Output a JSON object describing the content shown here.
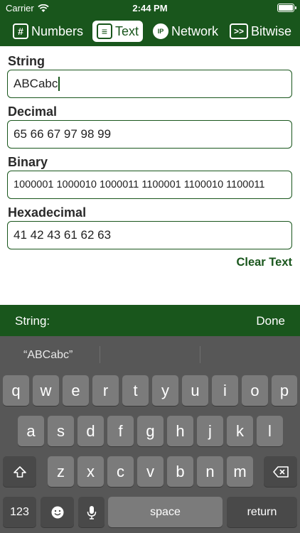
{
  "status": {
    "carrier": "Carrier",
    "time": "2:44 PM"
  },
  "tabs": [
    {
      "label": "Numbers",
      "icon": "#"
    },
    {
      "label": "Text",
      "icon": "≡"
    },
    {
      "label": "Network",
      "icon": "IP"
    },
    {
      "label": "Bitwise",
      "icon": ">>"
    }
  ],
  "fields": {
    "string": {
      "label": "String",
      "value": "ABCabc"
    },
    "decimal": {
      "label": "Decimal",
      "value": "65 66 67 97 98 99"
    },
    "binary": {
      "label": "Binary",
      "value": "1000001 1000010 1000011 1100001 1100010 1100011"
    },
    "hexadecimal": {
      "label": "Hexadecimal",
      "value": "41 42 43 61 62 63"
    }
  },
  "clear_label": "Clear Text",
  "accessory": {
    "label": "String:",
    "done": "Done"
  },
  "keyboard": {
    "suggestion": "“ABCabc”",
    "row1": [
      "q",
      "w",
      "e",
      "r",
      "t",
      "y",
      "u",
      "i",
      "o",
      "p"
    ],
    "row2": [
      "a",
      "s",
      "d",
      "f",
      "g",
      "h",
      "j",
      "k",
      "l"
    ],
    "row3": [
      "z",
      "x",
      "c",
      "v",
      "b",
      "n",
      "m"
    ],
    "numbers_key": "123",
    "space_key": "space",
    "return_key": "return"
  },
  "colors": {
    "accent": "#19561c",
    "keyboard_bg": "#575757",
    "key": "#7b7b7b"
  }
}
